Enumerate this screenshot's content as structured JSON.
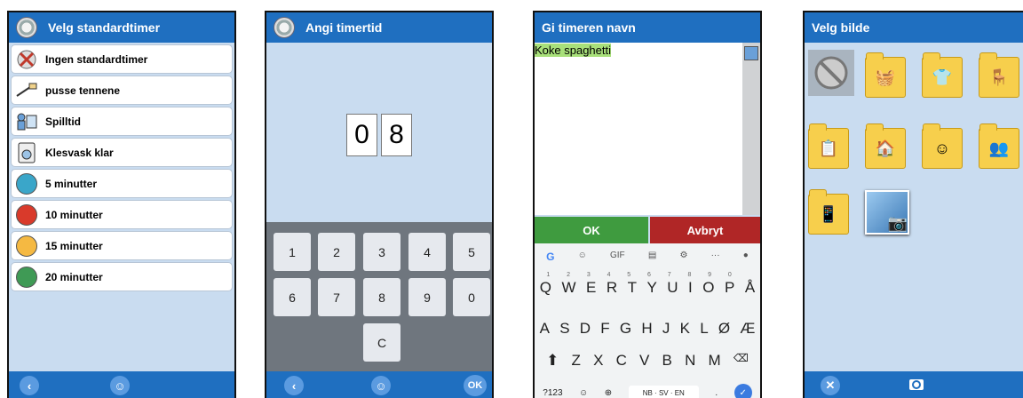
{
  "screen1": {
    "title": "Velg standardtimer",
    "items": [
      {
        "label": "Ingen standardtimer",
        "icon": "no-timer-icon"
      },
      {
        "label": "pusse tennene",
        "icon": "toothbrush-icon"
      },
      {
        "label": "Spilltid",
        "icon": "play-icon"
      },
      {
        "label": "Klesvask klar",
        "icon": "washing-machine-icon"
      },
      {
        "label": "5 minutter",
        "icon": "color-circle-icon",
        "color": "#3aa6c9"
      },
      {
        "label": "10 minutter",
        "icon": "color-circle-icon",
        "color": "#d93a2b"
      },
      {
        "label": "15 minutter",
        "icon": "color-circle-icon",
        "color": "#f5b942"
      },
      {
        "label": "20 minutter",
        "icon": "color-circle-icon",
        "color": "#3f9a55"
      }
    ],
    "back_icon": "back-chevron-icon",
    "profile_icon": "user-icon"
  },
  "screen2": {
    "title": "Angi timertid",
    "digits": [
      "0",
      "8"
    ],
    "keys": [
      "1",
      "2",
      "3",
      "4",
      "5",
      "6",
      "7",
      "8",
      "9",
      "0",
      "C"
    ],
    "ok_label": "OK"
  },
  "screen3": {
    "title": "Gi timeren navn",
    "text": "Koke spaghetti",
    "ok_label": "OK",
    "cancel_label": "Avbryt",
    "kb_row1": [
      "Q",
      "W",
      "E",
      "R",
      "T",
      "Y",
      "U",
      "I",
      "O",
      "P",
      "Å"
    ],
    "kb_row1_hints": [
      "1",
      "2",
      "3",
      "4",
      "5",
      "6",
      "7",
      "8",
      "9",
      "0",
      ""
    ],
    "kb_row2": [
      "A",
      "S",
      "D",
      "F",
      "G",
      "H",
      "J",
      "K",
      "L",
      "Ø",
      "Æ"
    ],
    "kb_row3": [
      "Z",
      "X",
      "C",
      "V",
      "B",
      "N",
      "M"
    ],
    "kb_tools": [
      "G",
      "GIF",
      "⚙",
      "···"
    ],
    "kb_mode": "?123",
    "kb_lang": "NB · SV · EN",
    "kb_period": "."
  },
  "screen4": {
    "title": "Velg bilde"
  }
}
